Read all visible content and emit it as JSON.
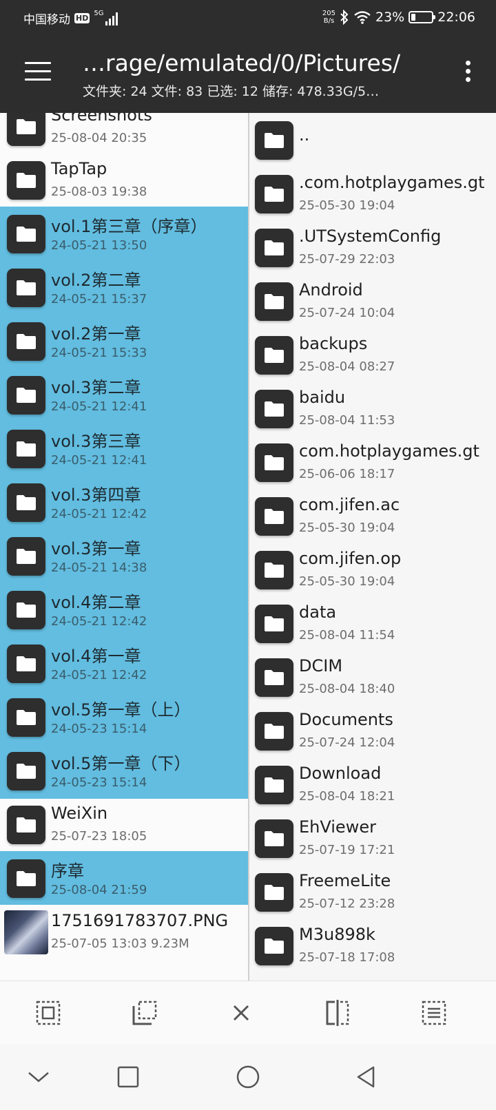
{
  "status_bar": {
    "carrier": "中国移动",
    "hd": "HD",
    "network": "5G",
    "speed_value": "205",
    "speed_unit": "B/s",
    "battery": "23%",
    "battery_level": 0.23,
    "time": "22:06"
  },
  "app_bar": {
    "path": "…rage/emulated/0/Pictures/",
    "summary": "文件夹: 24  文件: 83  已选: 12  储存: 478.33G/5…"
  },
  "left_pane": {
    "items": [
      {
        "name": "Screenshots",
        "meta": "25-08-04 20:35",
        "selected": false,
        "type": "folder"
      },
      {
        "name": "TapTap",
        "meta": "25-08-03 19:38",
        "selected": false,
        "type": "folder"
      },
      {
        "name": "vol.1第三章（序章）",
        "meta": "24-05-21 13:50",
        "selected": true,
        "type": "folder"
      },
      {
        "name": "vol.2第二章",
        "meta": "24-05-21 15:37",
        "selected": true,
        "type": "folder"
      },
      {
        "name": "vol.2第一章",
        "meta": "24-05-21 15:33",
        "selected": true,
        "type": "folder"
      },
      {
        "name": "vol.3第二章",
        "meta": "24-05-21 12:41",
        "selected": true,
        "type": "folder"
      },
      {
        "name": "vol.3第三章",
        "meta": "24-05-21 12:41",
        "selected": true,
        "type": "folder"
      },
      {
        "name": "vol.3第四章",
        "meta": "24-05-21 12:42",
        "selected": true,
        "type": "folder"
      },
      {
        "name": "vol.3第一章",
        "meta": "24-05-21 14:38",
        "selected": true,
        "type": "folder"
      },
      {
        "name": "vol.4第二章",
        "meta": "24-05-21 12:42",
        "selected": true,
        "type": "folder"
      },
      {
        "name": "vol.4第一章",
        "meta": "24-05-21 12:42",
        "selected": true,
        "type": "folder"
      },
      {
        "name": "vol.5第一章（上）",
        "meta": "24-05-23 15:14",
        "selected": true,
        "type": "folder"
      },
      {
        "name": "vol.5第一章（下）",
        "meta": "24-05-23 15:14",
        "selected": true,
        "type": "folder"
      },
      {
        "name": "WeiXin",
        "meta": "25-07-23 18:05",
        "selected": false,
        "type": "folder"
      },
      {
        "name": "序章",
        "meta": "25-08-04 21:59",
        "selected": true,
        "type": "folder"
      },
      {
        "name": "1751691783707.PNG",
        "meta": "25-07-05 13:03  9.23M",
        "selected": false,
        "type": "image"
      }
    ]
  },
  "right_pane": {
    "items": [
      {
        "name": "..",
        "meta": ""
      },
      {
        "name": ".com.hotplaygames.gt",
        "meta": "25-05-30 19:04"
      },
      {
        "name": ".UTSystemConfig",
        "meta": "25-07-29 22:03"
      },
      {
        "name": "Android",
        "meta": "25-07-24 10:04"
      },
      {
        "name": "backups",
        "meta": "25-08-04 08:27"
      },
      {
        "name": "baidu",
        "meta": "25-08-04 11:53"
      },
      {
        "name": "com.hotplaygames.gt",
        "meta": "25-06-06 18:17"
      },
      {
        "name": "com.jifen.ac",
        "meta": "25-05-30 19:04"
      },
      {
        "name": "com.jifen.op",
        "meta": "25-05-30 19:04"
      },
      {
        "name": "data",
        "meta": "25-08-04 11:54"
      },
      {
        "name": "DCIM",
        "meta": "25-08-04 18:40"
      },
      {
        "name": "Documents",
        "meta": "25-07-24 12:04"
      },
      {
        "name": "Download",
        "meta": "25-08-04 18:21"
      },
      {
        "name": "EhViewer",
        "meta": "25-07-19 17:21"
      },
      {
        "name": "FreemeLite",
        "meta": "25-07-12 23:28"
      },
      {
        "name": "M3u898k",
        "meta": "25-07-18 17:08"
      }
    ]
  },
  "toolbar": {
    "tools": [
      "select-all-icon",
      "select-range-icon",
      "close-icon",
      "invert-selection-icon",
      "select-list-icon"
    ]
  },
  "nav_bar": {
    "buttons": [
      "chevron-down-icon",
      "recents-square-icon",
      "home-circle-icon",
      "back-triangle-icon"
    ]
  },
  "colors": {
    "bar_bg": "#2d2d2d",
    "selection": "#62bde0",
    "folder_icon": "#2e2e2e"
  }
}
